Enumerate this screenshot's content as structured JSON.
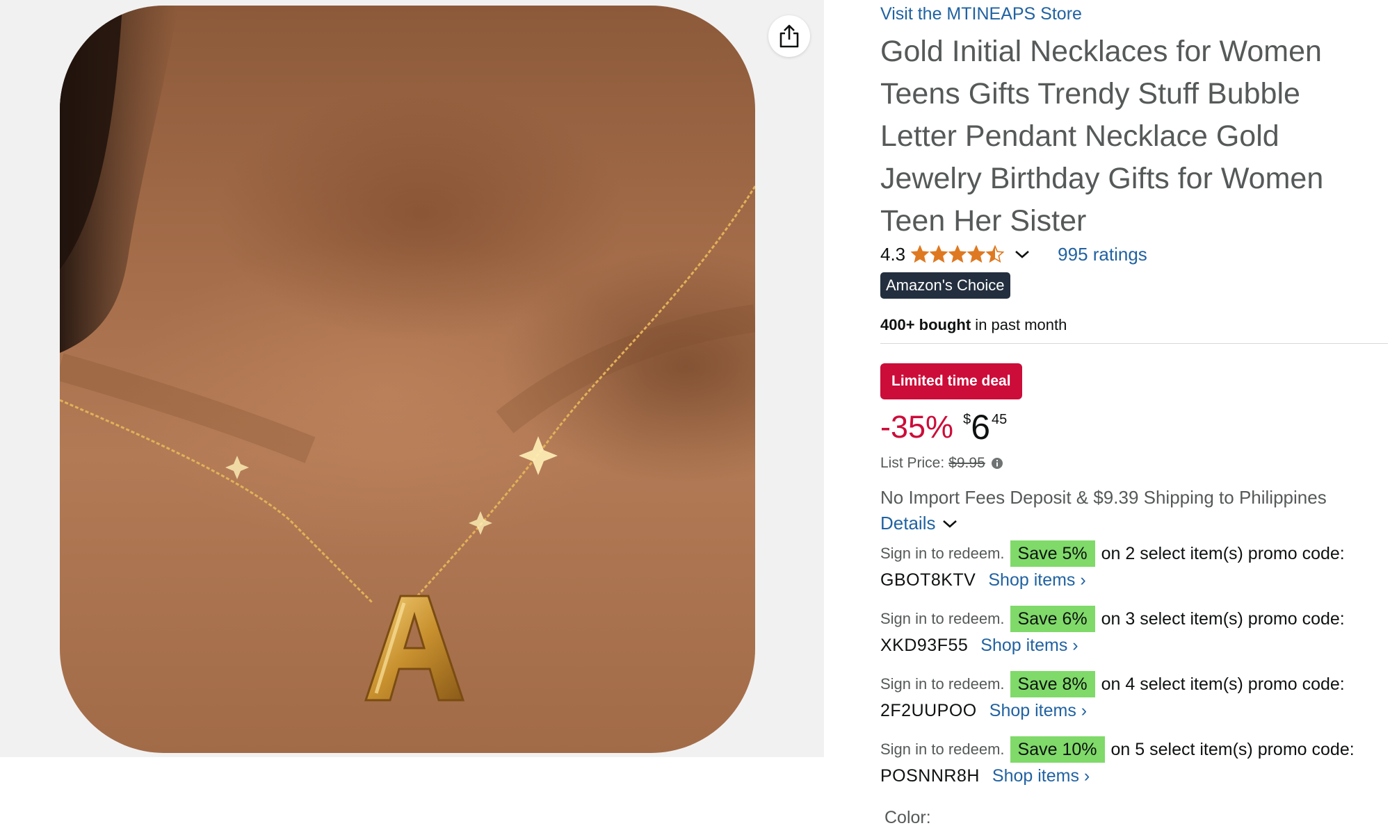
{
  "store": {
    "link_text": "Visit the MTINEAPS Store"
  },
  "product": {
    "title": "Gold Initial Necklaces for Women Teens Gifts Trendy Stuff Bubble Letter Pendant Necklace Gold Jewelry Birthday Gifts for Women Teen Her Sister",
    "pendant_letter": "A"
  },
  "rating": {
    "value": "4.3",
    "stars_out_of_5": 4.3,
    "ratings_count_text": "995 ratings",
    "star_color": "#de7921"
  },
  "badges": {
    "choice": "Amazon's Choice",
    "bought_count": "400+ bought",
    "bought_suffix": " in past month",
    "deal": "Limited time deal"
  },
  "pricing": {
    "discount": "-35%",
    "currency_symbol": "$",
    "price_whole": "6",
    "price_fraction": "45",
    "list_price_label": "List Price:",
    "list_price": "$9.95"
  },
  "shipping": {
    "text": "No Import Fees Deposit & $9.39 Shipping to Philippines",
    "details_label": "Details"
  },
  "promos": [
    {
      "signin": "Sign in to redeem.",
      "save": "Save 5%",
      "on_text": "on 2 select item(s) promo code:",
      "code": "GBOT8KTV",
      "shop": "Shop items ›"
    },
    {
      "signin": "Sign in to redeem.",
      "save": "Save 6%",
      "on_text": "on 3 select item(s) promo code:",
      "code": "XKD93F55",
      "shop": "Shop items ›"
    },
    {
      "signin": "Sign in to redeem.",
      "save": "Save 8%",
      "on_text": "on 4 select item(s) promo code:",
      "code": "2F2UUPOO",
      "shop": "Shop items ›"
    },
    {
      "signin": "Sign in to redeem.",
      "save": "Save 10%",
      "on_text": "on 5 select item(s) promo code:",
      "code": "POSNNR8H",
      "shop": "Shop items ›"
    }
  ],
  "variant": {
    "color_label": "Color:"
  },
  "icons": {
    "share": "share-icon",
    "star": "star-icon",
    "chevron": "chevron-down-icon",
    "info": "info-icon"
  },
  "colors": {
    "link": "#2162a1",
    "deal_red": "#cc0c39",
    "choice_badge_bg": "#232f3e",
    "promo_green": "#7fda69",
    "muted_text": "#565959"
  }
}
